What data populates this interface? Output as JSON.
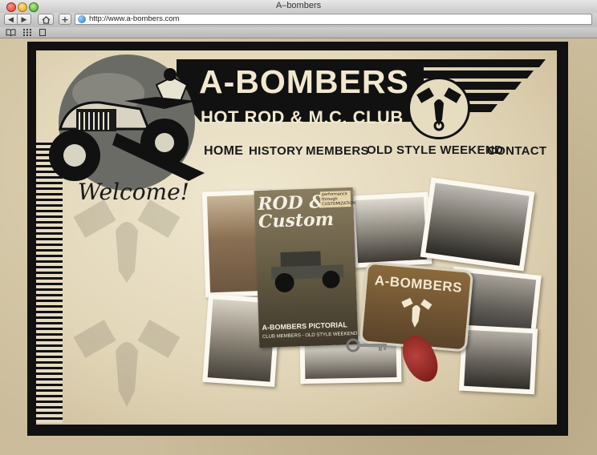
{
  "browser": {
    "window_title": "A–bombers",
    "url": "http://www.a-bombers.com",
    "back_icon": "back-arrow-icon",
    "forward_icon": "forward-arrow-icon"
  },
  "site": {
    "title": "A-BOMBERS",
    "subtitle": "HOT ROD & M.C. CLUB",
    "nav": [
      "HOME",
      "HISTORY",
      "MEMBERS",
      "OLD STYLE WEEKEND",
      "CONTACT"
    ],
    "welcome": "Welcome!",
    "magazine": {
      "title_line1": "ROD &",
      "title_line2": "Custom",
      "tag": "performance through CUSTOMIZATION",
      "footer_title": "A-BOMBERS PICTORIAL",
      "footer_sub": "CLUB MEMBERS - OLD STYLE WEEKEND"
    },
    "plate_text": "A-BOMBERS"
  },
  "colors": {
    "frame": "#111111",
    "paper": "#e2d6b8",
    "cream_text": "#f1e8cf"
  }
}
